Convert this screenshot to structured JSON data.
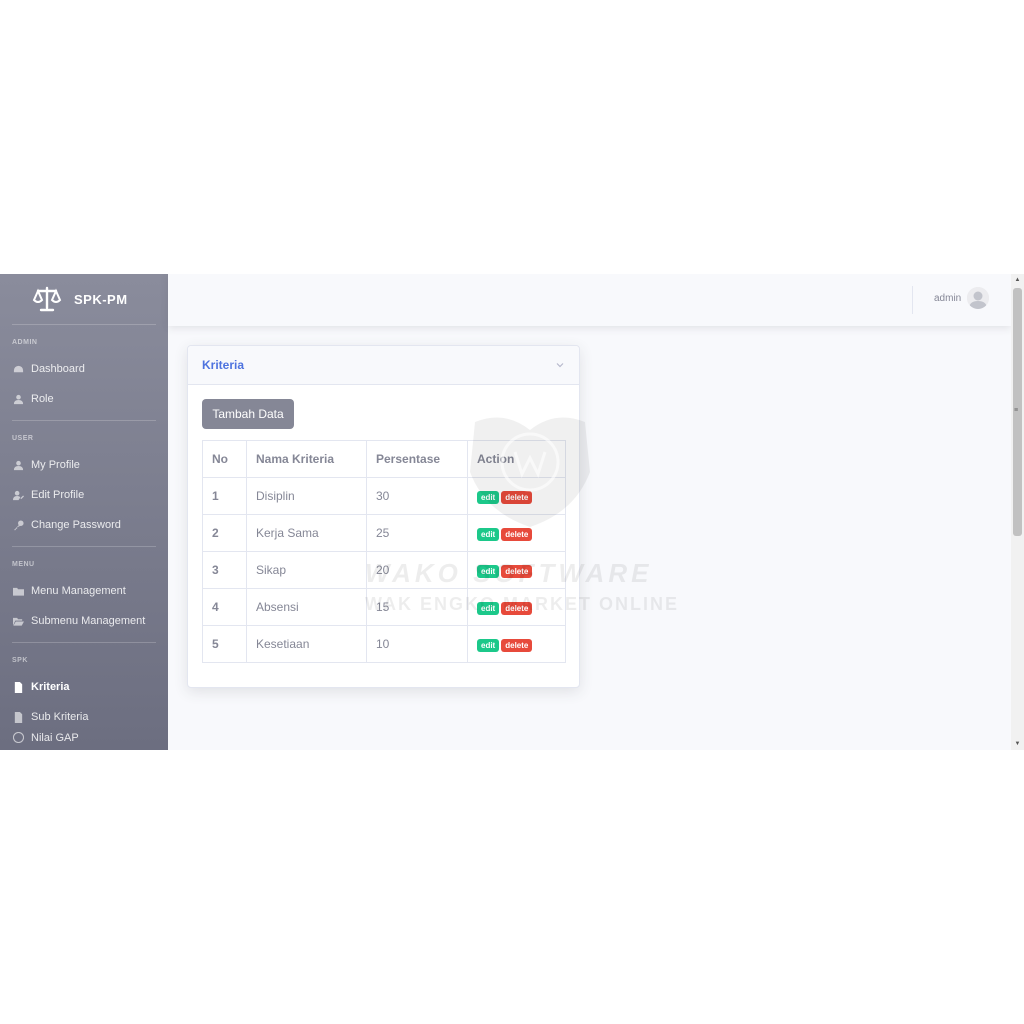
{
  "sidebar": {
    "brand": "SPK-PM",
    "sections": {
      "admin": "ADMIN",
      "user": "USER",
      "menu": "MENU",
      "spk": "SPK"
    },
    "items": {
      "dashboard": "Dashboard",
      "role": "Role",
      "my_profile": "My Profile",
      "edit_profile": "Edit Profile",
      "change_password": "Change Password",
      "menu_management": "Menu Management",
      "submenu_management": "Submenu Management",
      "kriteria": "Kriteria",
      "sub_kriteria": "Sub Kriteria",
      "nilai_gap": "Nilai GAP"
    },
    "active_item": "kriteria"
  },
  "topbar": {
    "user_name": "admin"
  },
  "card": {
    "title": "Kriteria",
    "add_button": "Tambah Data",
    "columns": [
      "No",
      "Nama Kriteria",
      "Persentase",
      "Action"
    ],
    "rows": [
      {
        "no": "1",
        "nama": "Disiplin",
        "persentase": "30"
      },
      {
        "no": "2",
        "nama": "Kerja Sama",
        "persentase": "25"
      },
      {
        "no": "3",
        "nama": "Sikap",
        "persentase": "20"
      },
      {
        "no": "4",
        "nama": "Absensi",
        "persentase": "15"
      },
      {
        "no": "5",
        "nama": "Kesetiaan",
        "persentase": "10"
      }
    ],
    "edit_label": "edit",
    "delete_label": "delete"
  },
  "watermark": {
    "line1": "WAKO SOFTWARE",
    "line2": "WAK ENGKO MARKET ONLINE"
  },
  "colors": {
    "primary": "#4e73df",
    "success": "#1cc88a",
    "danger": "#e74a3b",
    "secondary": "#858796"
  }
}
